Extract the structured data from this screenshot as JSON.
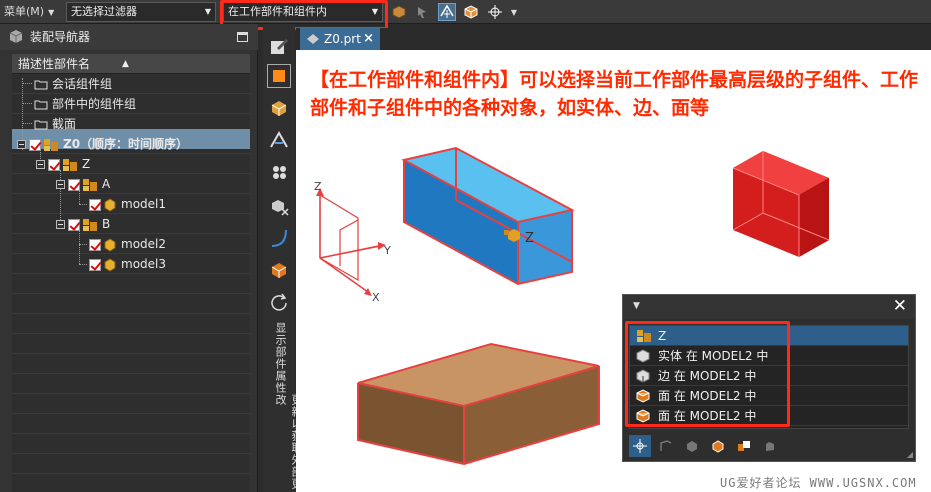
{
  "toolbar": {
    "menu_label": "菜单(M)",
    "filter_value": "无选择过滤器",
    "scope_value": "在工作部件和组件内"
  },
  "navigator": {
    "title": "装配导航器",
    "column_header": "描述性部件名",
    "nodes": {
      "session": "会话组件组",
      "components_in_part": "部件中的组件组",
      "section": "截面",
      "root": "Z0（顺序：时间顺序）",
      "z": "Z",
      "a": "A",
      "model1": "model1",
      "b": "B",
      "model2": "model2",
      "model3": "model3"
    }
  },
  "resource_bar": {
    "vertical_text_1": "显示部件属性",
    "vertical_text_2": "更新以获取外部更改"
  },
  "graphics": {
    "tab_label": "Z0.prt",
    "callout": "【在工作部件和组件内】可以选择当前工作部件最高层级的子组件、工作部件和子组件中的各种对象，如实体、边、面等",
    "triad": {
      "x": "X",
      "y": "Y",
      "z": "Z"
    },
    "assembly_label": "Z",
    "watermark": "UG爱好者论坛 WWW.UGSNX.COM"
  },
  "quickpick": {
    "items": [
      {
        "label": "Z",
        "icon": "component-icon"
      },
      {
        "label": "实体 在 MODEL2 中",
        "icon": "solid-body-icon"
      },
      {
        "label": "边 在 MODEL2 中",
        "icon": "edge-icon"
      },
      {
        "label": "面 在 MODEL2 中",
        "icon": "face-icon"
      },
      {
        "label": "面 在 MODEL2 中",
        "icon": "face-icon"
      }
    ]
  },
  "colors": {
    "highlight": "#ff2a1a",
    "selection_blue": "#2d5f8a",
    "callout_text": "#ff2a00"
  }
}
